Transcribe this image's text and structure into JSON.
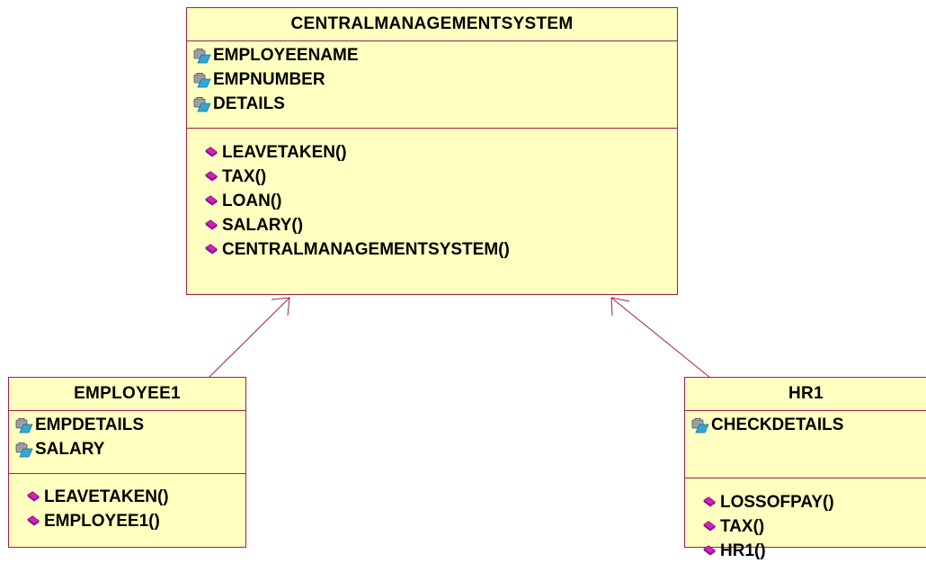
{
  "classes": {
    "central": {
      "name": "CENTRALMANAGEMENTSYSTEM",
      "attributes": [
        {
          "label": "EMPLOYEENAME",
          "icon": "private-attribute-icon"
        },
        {
          "label": "EMPNUMBER",
          "icon": "private-attribute-icon"
        },
        {
          "label": "DETAILS",
          "icon": "private-attribute-icon"
        }
      ],
      "operations": [
        {
          "label": "LEAVETAKEN()",
          "icon": "public-operation-icon"
        },
        {
          "label": "TAX()",
          "icon": "public-operation-icon"
        },
        {
          "label": "LOAN()",
          "icon": "public-operation-icon"
        },
        {
          "label": "SALARY()",
          "icon": "public-operation-icon"
        },
        {
          "label": "CENTRALMANAGEMENTSYSTEM()",
          "icon": "public-operation-icon"
        }
      ]
    },
    "employee1": {
      "name": "EMPLOYEE1",
      "attributes": [
        {
          "label": "EMPDETAILS",
          "icon": "private-attribute-icon"
        },
        {
          "label": "SALARY",
          "icon": "private-attribute-icon"
        }
      ],
      "operations": [
        {
          "label": "LEAVETAKEN()",
          "icon": "public-operation-icon"
        },
        {
          "label": "EMPLOYEE1()",
          "icon": "public-operation-icon"
        }
      ]
    },
    "hr1": {
      "name": "HR1",
      "attributes": [
        {
          "label": "CHECKDETAILS",
          "icon": "private-attribute-icon"
        }
      ],
      "operations": [
        {
          "label": "LOSSOFPAY()",
          "icon": "public-operation-icon"
        },
        {
          "label": "TAX()",
          "icon": "public-operation-icon"
        },
        {
          "label": "HR1()",
          "icon": "public-operation-icon"
        }
      ]
    }
  },
  "colors": {
    "class_fill": "#ffffc0",
    "border": "#a0204a",
    "attribute_icon_body": "#9aa0a8",
    "attribute_icon_accent": "#2fa8d8",
    "operation_icon": "#d020c0"
  }
}
